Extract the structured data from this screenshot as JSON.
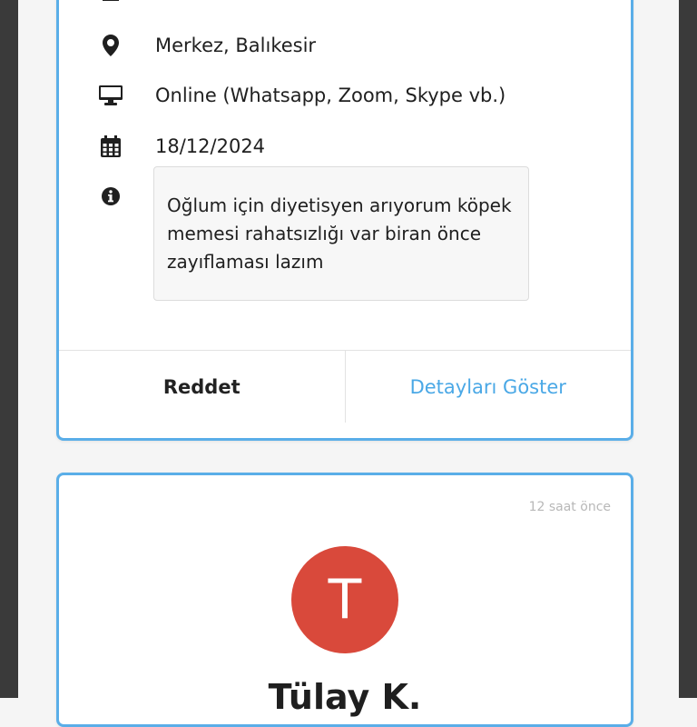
{
  "request_card": {
    "partial_row_text": "0/,,_,...",
    "location": "Merkez, Balıkesir",
    "session_type": "Online (Whatsapp, Zoom, Skype vb.)",
    "date": "18/12/2024",
    "note": "Oğlum için diyetisyen arıyorum köpek memesi rahatsızlığı var biran önce zayıflaması lazım",
    "actions": {
      "reject_label": "Reddet",
      "details_label": "Detayları Göster"
    }
  },
  "next_card": {
    "time_ago": "12 saat önce",
    "avatar_initial": "T",
    "name": "Tülay K."
  },
  "colors": {
    "card_border": "#5aaee8",
    "link": "#4aa8e6",
    "avatar_bg": "#d9493b",
    "side_bars": "#3a3a3a"
  }
}
